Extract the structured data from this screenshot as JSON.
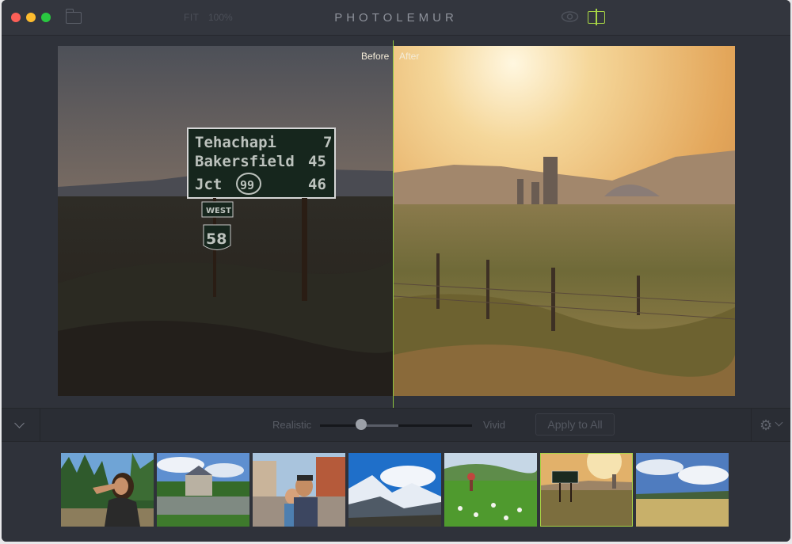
{
  "app": {
    "title": "PHOTOLEMUR",
    "fit_label": "FIT",
    "zoom_label": "100%"
  },
  "icons": {
    "folder": "folder-icon",
    "eye": "eye-icon",
    "split_view": "split-view-icon",
    "collapse": "chevron-down-icon",
    "settings": "gear-icon"
  },
  "viewer": {
    "before_label": "Before",
    "after_label": "After",
    "sign_lines": [
      "Tehachapi 7",
      "Bakersfield 45",
      "Jct 99 46"
    ],
    "sign_west": "WEST",
    "sign_route": "58"
  },
  "controls": {
    "realistic_label": "Realistic",
    "vivid_label": "Vivid",
    "slider_value": 0.27,
    "apply_label": "Apply to All"
  },
  "filmstrip": {
    "selected_index": 5,
    "count": 7
  },
  "colors": {
    "accent": "#a8d645",
    "window_bg": "#2f323a",
    "traffic_red": "#fc5f57",
    "traffic_yellow": "#fdbc2e",
    "traffic_green": "#29c840"
  }
}
